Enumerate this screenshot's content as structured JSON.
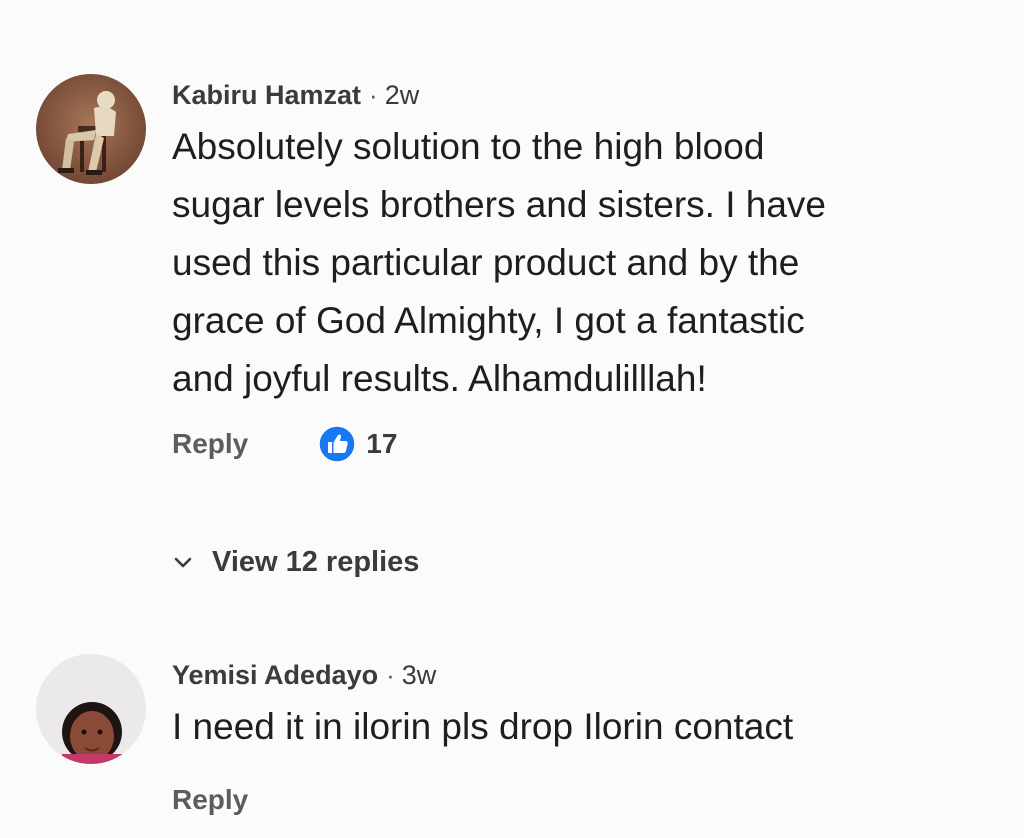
{
  "comments": [
    {
      "author": "Kabiru Hamzat",
      "separator": "·",
      "time": "2w",
      "text": "Absolutely solution to the high blood\nsugar levels brothers and sisters. I have\nused this particular product and by the\ngrace of God Almighty, I got a fantastic\nand joyful results. Alhamdulilllah!",
      "reply_label": "Reply",
      "like_count": "17",
      "view_replies_label": "View 12 replies",
      "avatar_icon": "user-photo-sitting-figure"
    },
    {
      "author": "Yemisi Adedayo",
      "separator": "·",
      "time": "3w",
      "text": "I need it in ilorin pls drop Ilorin contact",
      "reply_label": "Reply",
      "avatar_icon": "user-photo-portrait"
    }
  ],
  "colors": {
    "like_blue": "#1877f2",
    "background": "#fbfbfb",
    "text": "#1c1e21",
    "secondary_text": "#5b5c5e"
  }
}
